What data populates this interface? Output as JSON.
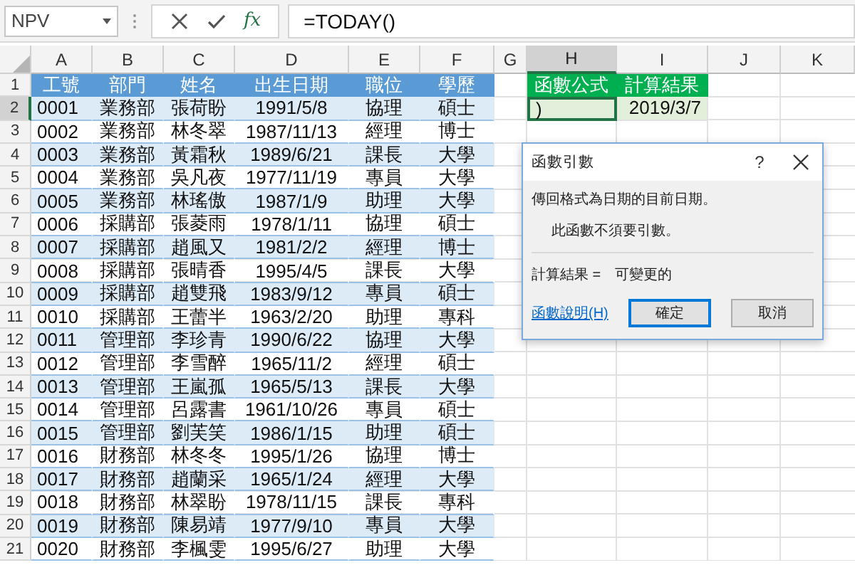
{
  "formula_bar": {
    "name_box": "NPV",
    "function_button": "fx",
    "formula": "=TODAY()"
  },
  "sheet": {
    "columns": [
      {
        "label": "A",
        "selected": false
      },
      {
        "label": "B",
        "selected": false
      },
      {
        "label": "C",
        "selected": false
      },
      {
        "label": "D",
        "selected": false
      },
      {
        "label": "E",
        "selected": false
      },
      {
        "label": "F",
        "selected": false
      },
      {
        "label": "G",
        "selected": false
      },
      {
        "label": "H",
        "selected": true
      },
      {
        "label": "I",
        "selected": false
      },
      {
        "label": "J",
        "selected": false
      },
      {
        "label": "K",
        "selected": false
      }
    ],
    "rows": [
      {
        "number": "1",
        "selected": false,
        "kind": "header",
        "table": [
          "工號",
          "部門",
          "姓名",
          "出生日期",
          "職位",
          "學歷"
        ],
        "side": [
          {
            "text": "函數公式",
            "kind": "header",
            "selected": false
          },
          {
            "text": "計算結果",
            "kind": "header",
            "selected": false
          }
        ]
      },
      {
        "number": "2",
        "selected": true,
        "kind": "data",
        "table": [
          "0001",
          "業務部",
          "張荷盼",
          "1991/5/8",
          "協理",
          "碩士"
        ],
        "side": [
          {
            "text": ")",
            "kind": "value",
            "selected": true
          },
          {
            "text": "2019/3/7",
            "kind": "value",
            "selected": false
          }
        ]
      },
      {
        "number": "3",
        "selected": false,
        "kind": "data",
        "table": [
          "0002",
          "業務部",
          "林冬翠",
          "1987/11/13",
          "經理",
          "博士"
        ]
      },
      {
        "number": "4",
        "selected": false,
        "kind": "data",
        "table": [
          "0003",
          "業務部",
          "黃霜秋",
          "1989/6/21",
          "課長",
          "大學"
        ]
      },
      {
        "number": "5",
        "selected": false,
        "kind": "data",
        "table": [
          "0004",
          "業務部",
          "吳凡夜",
          "1977/11/19",
          "專員",
          "大學"
        ]
      },
      {
        "number": "6",
        "selected": false,
        "kind": "data",
        "table": [
          "0005",
          "業務部",
          "林瑤傲",
          "1987/1/9",
          "助理",
          "大學"
        ]
      },
      {
        "number": "7",
        "selected": false,
        "kind": "data",
        "table": [
          "0006",
          "採購部",
          "張菱雨",
          "1978/1/11",
          "協理",
          "碩士"
        ]
      },
      {
        "number": "8",
        "selected": false,
        "kind": "data",
        "table": [
          "0007",
          "採購部",
          "趙風又",
          "1981/2/2",
          "經理",
          "博士"
        ]
      },
      {
        "number": "9",
        "selected": false,
        "kind": "data",
        "table": [
          "0008",
          "採購部",
          "張晴香",
          "1995/4/5",
          "課長",
          "大學"
        ]
      },
      {
        "number": "10",
        "selected": false,
        "kind": "data",
        "table": [
          "0009",
          "採購部",
          "趙雙飛",
          "1983/9/12",
          "專員",
          "碩士"
        ]
      },
      {
        "number": "11",
        "selected": false,
        "kind": "data",
        "table": [
          "0010",
          "採購部",
          "王蕾半",
          "1963/2/20",
          "助理",
          "專科"
        ]
      },
      {
        "number": "12",
        "selected": false,
        "kind": "data",
        "table": [
          "0011",
          "管理部",
          "李珍青",
          "1990/6/22",
          "協理",
          "大學"
        ]
      },
      {
        "number": "13",
        "selected": false,
        "kind": "data",
        "table": [
          "0012",
          "管理部",
          "李雪醉",
          "1965/11/2",
          "經理",
          "碩士"
        ]
      },
      {
        "number": "14",
        "selected": false,
        "kind": "data",
        "table": [
          "0013",
          "管理部",
          "王嵐孤",
          "1965/5/13",
          "課長",
          "大學"
        ]
      },
      {
        "number": "15",
        "selected": false,
        "kind": "data",
        "table": [
          "0014",
          "管理部",
          "呂露書",
          "1961/10/26",
          "專員",
          "碩士"
        ]
      },
      {
        "number": "16",
        "selected": false,
        "kind": "data",
        "table": [
          "0015",
          "管理部",
          "劉芙笑",
          "1986/1/15",
          "助理",
          "碩士"
        ]
      },
      {
        "number": "17",
        "selected": false,
        "kind": "data",
        "table": [
          "0016",
          "財務部",
          "林冬冬",
          "1995/1/26",
          "協理",
          "博士"
        ]
      },
      {
        "number": "18",
        "selected": false,
        "kind": "data",
        "table": [
          "0017",
          "財務部",
          "趙蘭采",
          "1965/1/24",
          "經理",
          "大學"
        ]
      },
      {
        "number": "19",
        "selected": false,
        "kind": "data",
        "table": [
          "0018",
          "財務部",
          "林翠盼",
          "1978/11/15",
          "課長",
          "專科"
        ]
      },
      {
        "number": "20",
        "selected": false,
        "kind": "data",
        "table": [
          "0019",
          "財務部",
          "陳易靖",
          "1977/9/10",
          "專員",
          "大學"
        ]
      },
      {
        "number": "21",
        "selected": false,
        "kind": "data",
        "table": [
          "0020",
          "財務部",
          "李楓雯",
          "1995/6/27",
          "助理",
          "大學"
        ]
      }
    ]
  },
  "dialog": {
    "title": "函數引數",
    "help": "?",
    "description": "傳回格式為日期的目前日期。",
    "note": "此函數不須要引數。",
    "result_label": "計算結果 =",
    "result_value": "可變更的",
    "help_link": "函數說明(H)",
    "buttons": [
      {
        "label": "確定",
        "default": true
      },
      {
        "label": "取消",
        "default": false
      }
    ]
  }
}
